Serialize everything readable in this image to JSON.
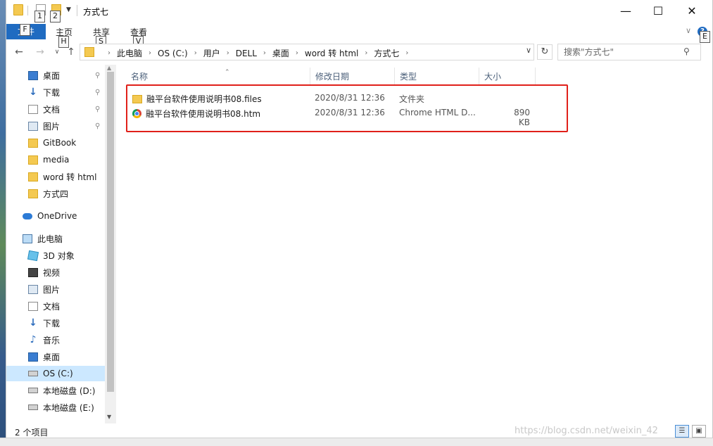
{
  "window": {
    "title": "方式七"
  },
  "quick_access_keytips": [
    "1",
    "2"
  ],
  "ribbon": {
    "file": {
      "label": "文件",
      "keytip": "F"
    },
    "tabs": [
      {
        "label": "主页",
        "keytip": "H"
      },
      {
        "label": "共享",
        "keytip": "S"
      },
      {
        "label": "查看",
        "keytip": "V"
      }
    ],
    "help_keytip": "E"
  },
  "address": {
    "crumbs": [
      "此电脑",
      "OS (C:)",
      "用户",
      "DELL",
      "桌面",
      "word 转 html",
      "方式七"
    ],
    "search_placeholder": "搜索\"方式七\""
  },
  "nav": {
    "quick_access": [
      {
        "label": "桌面",
        "icon": "desktop-icon",
        "pinned": true
      },
      {
        "label": "下载",
        "icon": "download-icon",
        "pinned": true
      },
      {
        "label": "文档",
        "icon": "document-icon",
        "pinned": true
      },
      {
        "label": "图片",
        "icon": "picture-icon",
        "pinned": true
      },
      {
        "label": "GitBook",
        "icon": "folder-icon"
      },
      {
        "label": "media",
        "icon": "folder-icon"
      },
      {
        "label": "word 转 html",
        "icon": "folder-icon"
      },
      {
        "label": "方式四",
        "icon": "folder-icon"
      }
    ],
    "onedrive": "OneDrive",
    "this_pc": "此电脑",
    "pc_items": [
      {
        "label": "3D 对象",
        "icon": "cube-icon"
      },
      {
        "label": "视频",
        "icon": "video-icon"
      },
      {
        "label": "图片",
        "icon": "picture-icon"
      },
      {
        "label": "文档",
        "icon": "document-icon"
      },
      {
        "label": "下载",
        "icon": "download-icon"
      },
      {
        "label": "音乐",
        "icon": "music-icon"
      },
      {
        "label": "桌面",
        "icon": "desktop-icon"
      },
      {
        "label": "OS (C:)",
        "icon": "drive-icon",
        "selected": true
      },
      {
        "label": "本地磁盘 (D:)",
        "icon": "drive-icon"
      },
      {
        "label": "本地磁盘 (E:)",
        "icon": "drive-icon"
      }
    ]
  },
  "columns": {
    "name": "名称",
    "date": "修改日期",
    "type": "类型",
    "size": "大小"
  },
  "files": [
    {
      "name": "融平台软件使用说明书08.files",
      "date": "2020/8/31 12:36",
      "type": "文件夹",
      "size": "",
      "icon": "folder-icon"
    },
    {
      "name": "融平台软件使用说明书08.htm",
      "date": "2020/8/31 12:36",
      "type": "Chrome HTML D...",
      "size": "890 KB",
      "icon": "chrome-icon"
    }
  ],
  "status": {
    "count": "2 个项目",
    "watermark": "https://blog.csdn.net/weixin_42"
  },
  "colors": {
    "file_tab": "#1f6bc1",
    "selection": "#cce8ff",
    "highlight_border": "#e0201a"
  }
}
